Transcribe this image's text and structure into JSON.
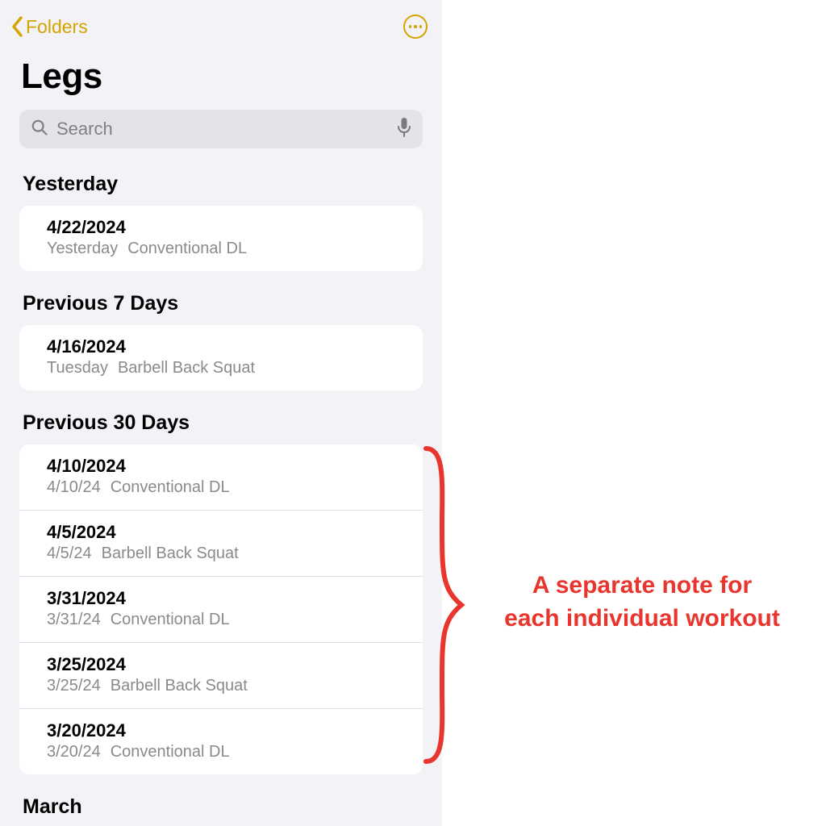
{
  "nav": {
    "back_label": "Folders"
  },
  "title": "Legs",
  "search": {
    "placeholder": "Search"
  },
  "sections": {
    "yesterday": {
      "header": "Yesterday",
      "items": [
        {
          "title": "4/22/2024",
          "meta_date": "Yesterday",
          "meta_text": "Conventional DL"
        }
      ]
    },
    "prev7": {
      "header": "Previous 7 Days",
      "items": [
        {
          "title": "4/16/2024",
          "meta_date": "Tuesday",
          "meta_text": "Barbell Back Squat"
        }
      ]
    },
    "prev30": {
      "header": "Previous 30 Days",
      "items": [
        {
          "title": "4/10/2024",
          "meta_date": "4/10/24",
          "meta_text": "Conventional DL"
        },
        {
          "title": "4/5/2024",
          "meta_date": "4/5/24",
          "meta_text": "Barbell Back Squat"
        },
        {
          "title": "3/31/2024",
          "meta_date": "3/31/24",
          "meta_text": "Conventional DL"
        },
        {
          "title": "3/25/2024",
          "meta_date": "3/25/24",
          "meta_text": "Barbell Back Squat"
        },
        {
          "title": "3/20/2024",
          "meta_date": "3/20/24",
          "meta_text": "Conventional DL"
        }
      ]
    },
    "march": {
      "header": "March"
    }
  },
  "annotation": {
    "line1": "A separate note for",
    "line2": "each individual workout"
  },
  "colors": {
    "accent": "#d6a400",
    "annotation": "#e8362f"
  }
}
